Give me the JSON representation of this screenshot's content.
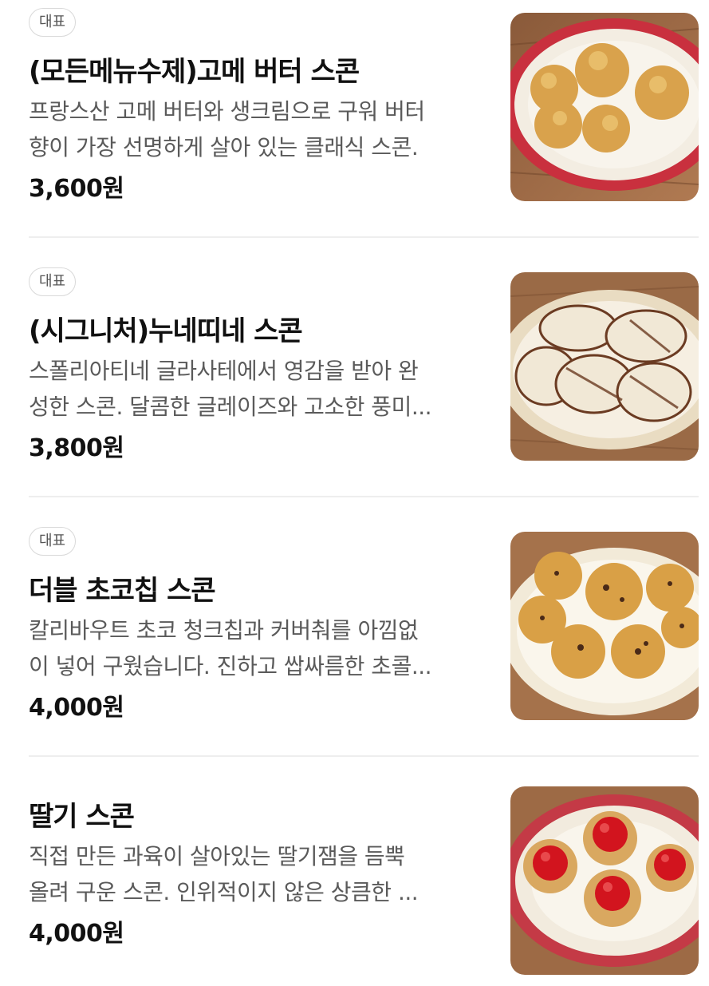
{
  "menu": {
    "items": [
      {
        "badge": "대표",
        "title": "(모든메뉴수제)고메 버터 스콘",
        "desc_line1": "프랑스산 고메 버터와 생크림으로 구워 버터",
        "desc_line2": "향이 가장 선명하게 살아 있는 클래식 스콘.",
        "price": "3,600원",
        "image_icon": "butter-scone-photo"
      },
      {
        "badge": "대표",
        "title": "(시그니처)누네띠네 스콘",
        "desc_line1": "스폴리아티네 글라사테에서 영감을 받아 완",
        "desc_line2": "성한 스콘. 달콤한 글레이즈와 고소한 풍미...",
        "price": "3,800원",
        "image_icon": "glazed-scone-photo"
      },
      {
        "badge": "대표",
        "title": "더블 초코칩 스콘",
        "desc_line1": "칼리바우트 초코 청크칩과 커버춰를 아낌없",
        "desc_line2": "이 넣어 구웠습니다. 진하고 쌉싸름한 초콜...",
        "price": "4,000원",
        "image_icon": "chocochip-scone-photo"
      },
      {
        "badge": "",
        "title": "딸기 스콘",
        "desc_line1": "직접 만든 과육이 살아있는 딸기잼을 듬뿍",
        "desc_line2": "올려 구운 스콘. 인위적이지 않은 상큼한 ...",
        "price": "4,000원",
        "image_icon": "strawberry-scone-photo"
      }
    ]
  },
  "colors": {
    "badge_border": "#d9d9d9",
    "title": "#111111",
    "description": "#5a5a5a",
    "divider": "#eeeeee"
  }
}
